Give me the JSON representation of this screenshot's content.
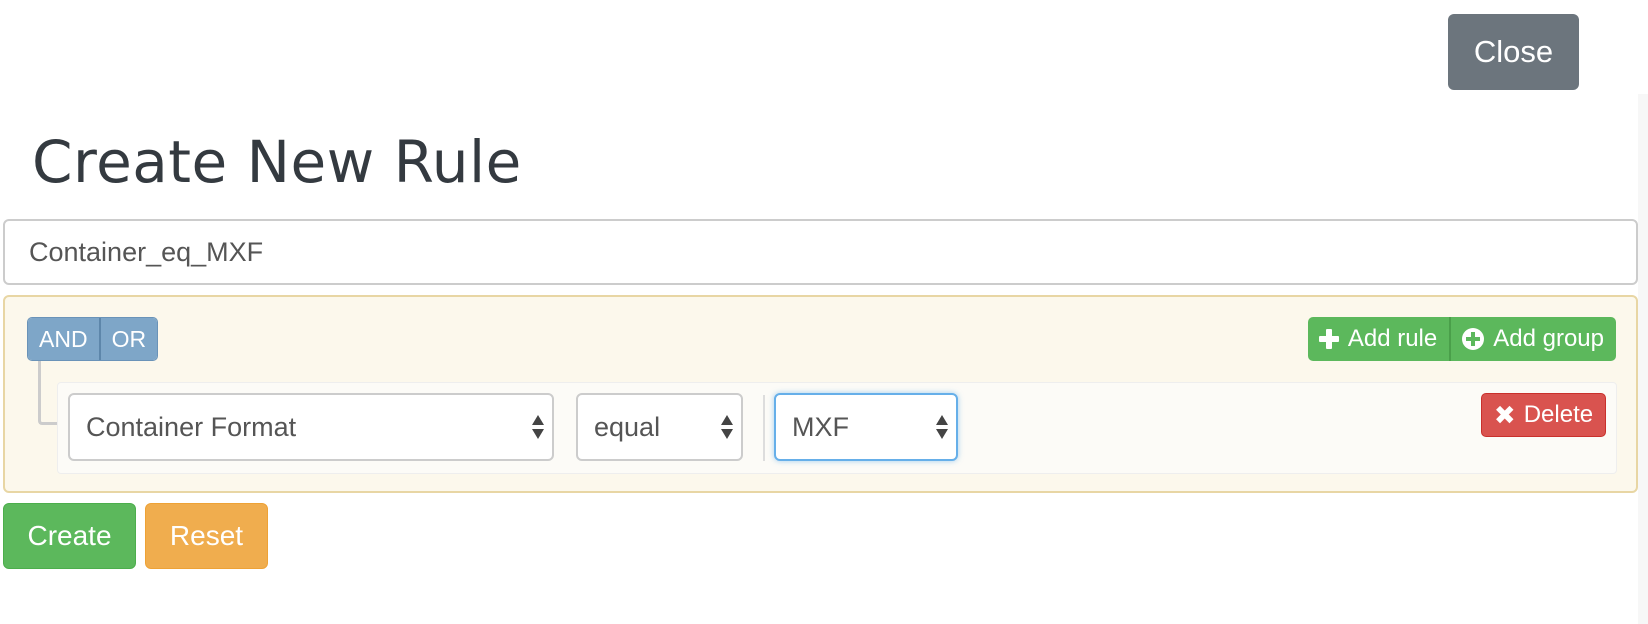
{
  "header": {
    "close_label": "Close",
    "title": "Create New Rule"
  },
  "form": {
    "rule_name_value": "Container_eq_MXF"
  },
  "group": {
    "conditions": [
      "AND",
      "OR"
    ],
    "add_rule_label": "Add rule",
    "add_group_label": "Add group",
    "rule": {
      "field": "Container Format",
      "operator": "equal",
      "value": "MXF",
      "delete_label": "Delete"
    }
  },
  "actions": {
    "create_label": "Create",
    "reset_label": "Reset"
  },
  "colors": {
    "close": "#6c757d",
    "condition": "#7ea6c8",
    "success": "#5cb85c",
    "danger": "#d9534f",
    "warning": "#f0ad4e",
    "group_bg": "#fcf8ec"
  }
}
